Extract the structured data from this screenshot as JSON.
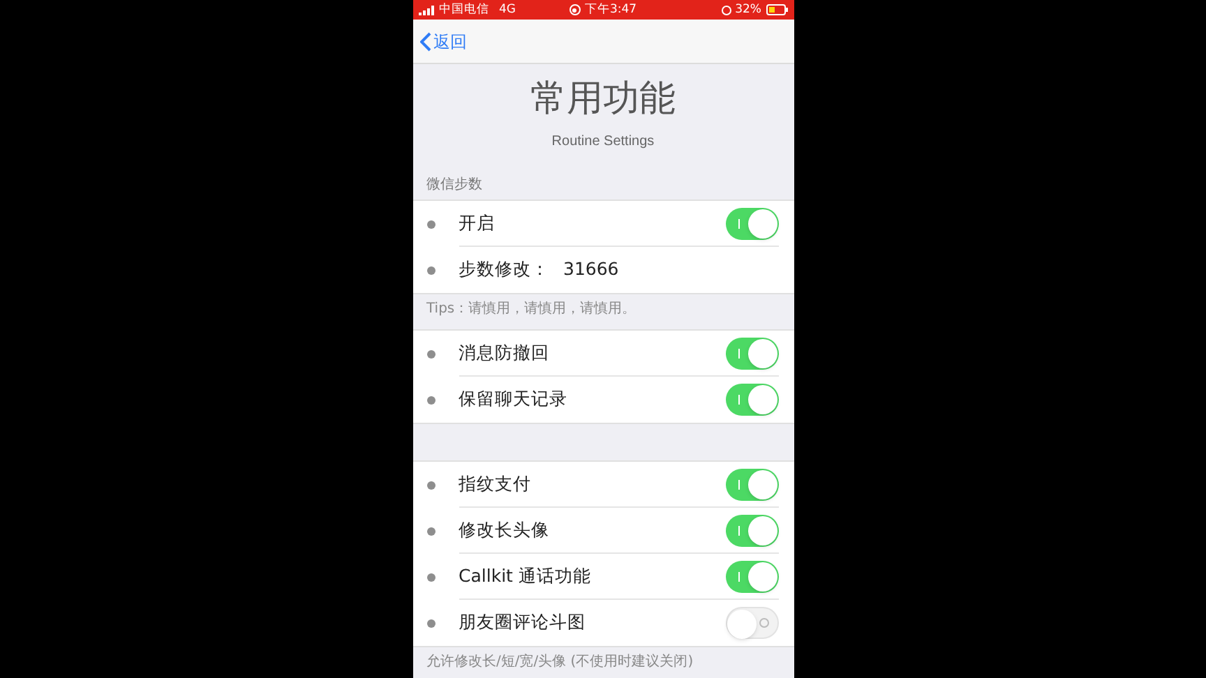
{
  "status_bar": {
    "carrier": "中国电信",
    "network": "4G",
    "time": "下午3:47",
    "battery": "32%"
  },
  "nav": {
    "back": "返回"
  },
  "header": {
    "title": "常用功能",
    "subtitle": "Routine Settings"
  },
  "sections": [
    {
      "header": "微信步数",
      "footer": "Tips：请慎用，请慎用，请慎用。",
      "rows": [
        {
          "kind": "toggle",
          "label": "开启",
          "on": true
        },
        {
          "kind": "value",
          "label": "步数修改：",
          "value": "31666"
        }
      ]
    },
    {
      "rows": [
        {
          "kind": "toggle",
          "label": "消息防撤回",
          "on": true
        },
        {
          "kind": "toggle",
          "label": "保留聊天记录",
          "on": true
        }
      ]
    },
    {
      "footer": "允许修改长/短/宽/头像 (不使用时建议关闭)",
      "rows": [
        {
          "kind": "toggle",
          "label": "指纹支付",
          "on": true
        },
        {
          "kind": "toggle",
          "label": "修改长头像",
          "on": true
        },
        {
          "kind": "toggle",
          "label": "Callkit 通话功能",
          "on": true
        },
        {
          "kind": "toggle",
          "label": "朋友圈评论斗图",
          "on": false
        }
      ]
    }
  ]
}
